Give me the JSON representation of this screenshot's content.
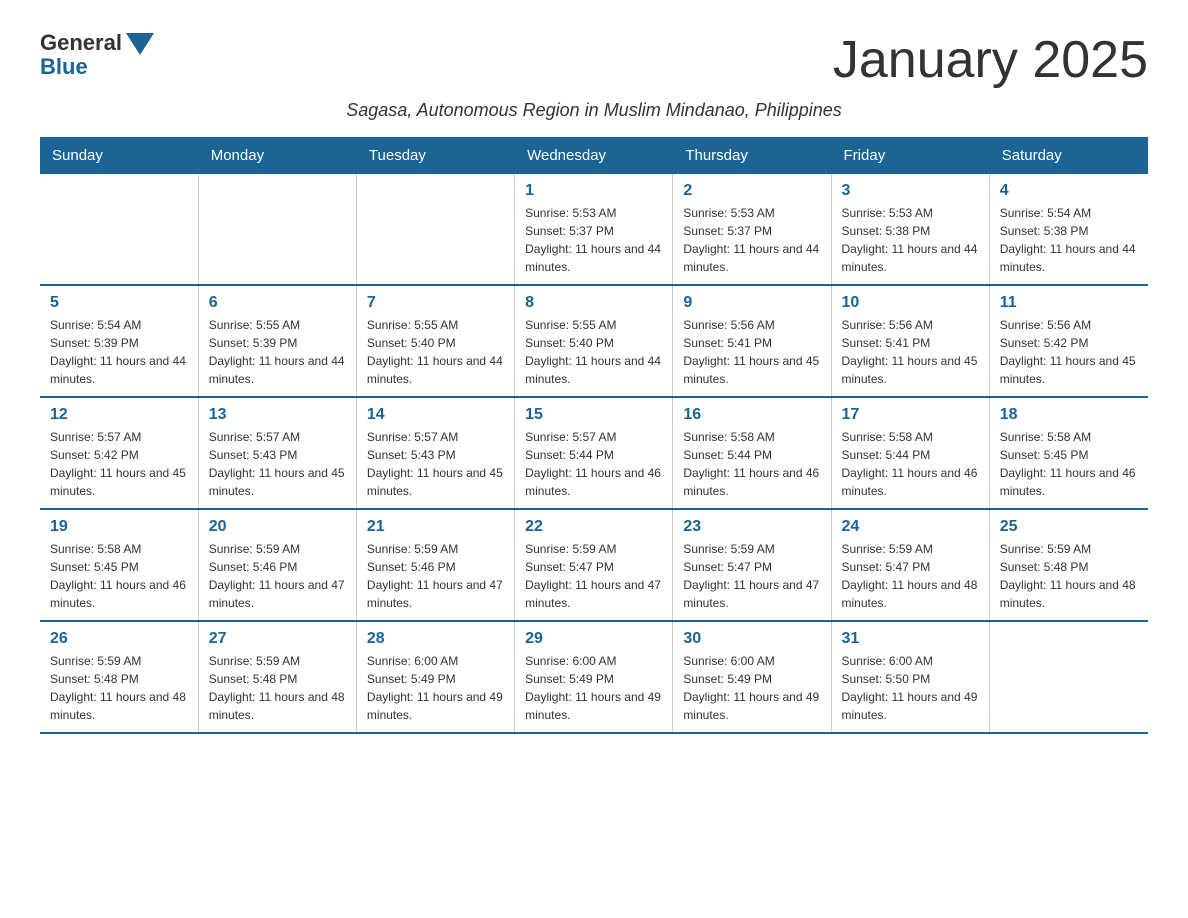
{
  "logo": {
    "general": "General",
    "blue": "Blue"
  },
  "title": "January 2025",
  "subtitle": "Sagasa, Autonomous Region in Muslim Mindanao, Philippines",
  "days_of_week": [
    "Sunday",
    "Monday",
    "Tuesday",
    "Wednesday",
    "Thursday",
    "Friday",
    "Saturday"
  ],
  "weeks": [
    {
      "days": [
        {
          "num": "",
          "info": ""
        },
        {
          "num": "",
          "info": ""
        },
        {
          "num": "",
          "info": ""
        },
        {
          "num": "1",
          "info": "Sunrise: 5:53 AM\nSunset: 5:37 PM\nDaylight: 11 hours and 44 minutes."
        },
        {
          "num": "2",
          "info": "Sunrise: 5:53 AM\nSunset: 5:37 PM\nDaylight: 11 hours and 44 minutes."
        },
        {
          "num": "3",
          "info": "Sunrise: 5:53 AM\nSunset: 5:38 PM\nDaylight: 11 hours and 44 minutes."
        },
        {
          "num": "4",
          "info": "Sunrise: 5:54 AM\nSunset: 5:38 PM\nDaylight: 11 hours and 44 minutes."
        }
      ]
    },
    {
      "days": [
        {
          "num": "5",
          "info": "Sunrise: 5:54 AM\nSunset: 5:39 PM\nDaylight: 11 hours and 44 minutes."
        },
        {
          "num": "6",
          "info": "Sunrise: 5:55 AM\nSunset: 5:39 PM\nDaylight: 11 hours and 44 minutes."
        },
        {
          "num": "7",
          "info": "Sunrise: 5:55 AM\nSunset: 5:40 PM\nDaylight: 11 hours and 44 minutes."
        },
        {
          "num": "8",
          "info": "Sunrise: 5:55 AM\nSunset: 5:40 PM\nDaylight: 11 hours and 44 minutes."
        },
        {
          "num": "9",
          "info": "Sunrise: 5:56 AM\nSunset: 5:41 PM\nDaylight: 11 hours and 45 minutes."
        },
        {
          "num": "10",
          "info": "Sunrise: 5:56 AM\nSunset: 5:41 PM\nDaylight: 11 hours and 45 minutes."
        },
        {
          "num": "11",
          "info": "Sunrise: 5:56 AM\nSunset: 5:42 PM\nDaylight: 11 hours and 45 minutes."
        }
      ]
    },
    {
      "days": [
        {
          "num": "12",
          "info": "Sunrise: 5:57 AM\nSunset: 5:42 PM\nDaylight: 11 hours and 45 minutes."
        },
        {
          "num": "13",
          "info": "Sunrise: 5:57 AM\nSunset: 5:43 PM\nDaylight: 11 hours and 45 minutes."
        },
        {
          "num": "14",
          "info": "Sunrise: 5:57 AM\nSunset: 5:43 PM\nDaylight: 11 hours and 45 minutes."
        },
        {
          "num": "15",
          "info": "Sunrise: 5:57 AM\nSunset: 5:44 PM\nDaylight: 11 hours and 46 minutes."
        },
        {
          "num": "16",
          "info": "Sunrise: 5:58 AM\nSunset: 5:44 PM\nDaylight: 11 hours and 46 minutes."
        },
        {
          "num": "17",
          "info": "Sunrise: 5:58 AM\nSunset: 5:44 PM\nDaylight: 11 hours and 46 minutes."
        },
        {
          "num": "18",
          "info": "Sunrise: 5:58 AM\nSunset: 5:45 PM\nDaylight: 11 hours and 46 minutes."
        }
      ]
    },
    {
      "days": [
        {
          "num": "19",
          "info": "Sunrise: 5:58 AM\nSunset: 5:45 PM\nDaylight: 11 hours and 46 minutes."
        },
        {
          "num": "20",
          "info": "Sunrise: 5:59 AM\nSunset: 5:46 PM\nDaylight: 11 hours and 47 minutes."
        },
        {
          "num": "21",
          "info": "Sunrise: 5:59 AM\nSunset: 5:46 PM\nDaylight: 11 hours and 47 minutes."
        },
        {
          "num": "22",
          "info": "Sunrise: 5:59 AM\nSunset: 5:47 PM\nDaylight: 11 hours and 47 minutes."
        },
        {
          "num": "23",
          "info": "Sunrise: 5:59 AM\nSunset: 5:47 PM\nDaylight: 11 hours and 47 minutes."
        },
        {
          "num": "24",
          "info": "Sunrise: 5:59 AM\nSunset: 5:47 PM\nDaylight: 11 hours and 48 minutes."
        },
        {
          "num": "25",
          "info": "Sunrise: 5:59 AM\nSunset: 5:48 PM\nDaylight: 11 hours and 48 minutes."
        }
      ]
    },
    {
      "days": [
        {
          "num": "26",
          "info": "Sunrise: 5:59 AM\nSunset: 5:48 PM\nDaylight: 11 hours and 48 minutes."
        },
        {
          "num": "27",
          "info": "Sunrise: 5:59 AM\nSunset: 5:48 PM\nDaylight: 11 hours and 48 minutes."
        },
        {
          "num": "28",
          "info": "Sunrise: 6:00 AM\nSunset: 5:49 PM\nDaylight: 11 hours and 49 minutes."
        },
        {
          "num": "29",
          "info": "Sunrise: 6:00 AM\nSunset: 5:49 PM\nDaylight: 11 hours and 49 minutes."
        },
        {
          "num": "30",
          "info": "Sunrise: 6:00 AM\nSunset: 5:49 PM\nDaylight: 11 hours and 49 minutes."
        },
        {
          "num": "31",
          "info": "Sunrise: 6:00 AM\nSunset: 5:50 PM\nDaylight: 11 hours and 49 minutes."
        },
        {
          "num": "",
          "info": ""
        }
      ]
    }
  ]
}
